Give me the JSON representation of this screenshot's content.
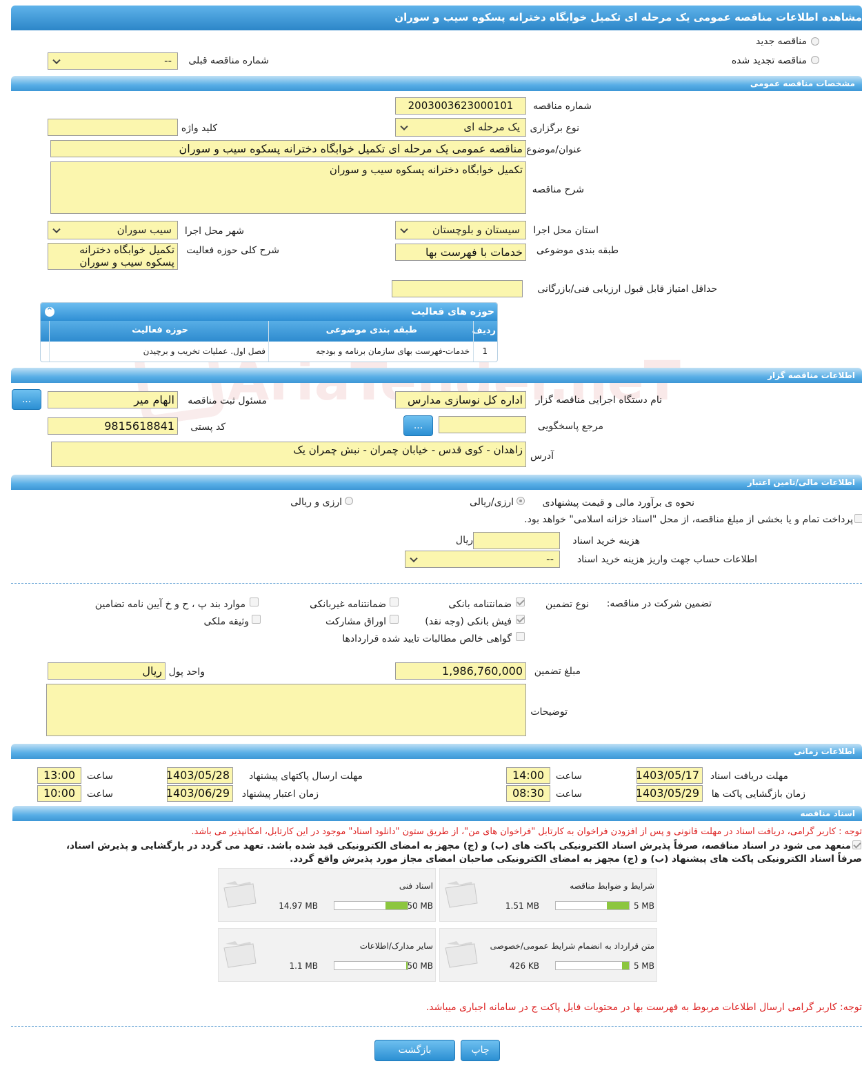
{
  "page_title": "مشاهده اطلاعات مناقصه عمومی یک مرحله ای تکمیل خوابگاه دخترانه پسکوه سیب و سوران",
  "header": {
    "new_tender": "مناقصه جدید",
    "renewed_tender": "مناقصه تجدید شده",
    "prev_tender_label": "شماره مناقصه قبلی",
    "prev_tender_value": "--"
  },
  "general": {
    "section": "مشخصات مناقصه عمومی",
    "tender_no_label": "شماره مناقصه",
    "tender_no": "2003003623000101",
    "keyword_label": "کلید واژه",
    "keyword": "",
    "holding_type_label": "نوع برگزاری",
    "holding_type": "یک مرحله ای",
    "subject_label": "عنوان/موضوع مناقصه",
    "subject": "مناقصه عمومی یک مرحله ای تکمیل خوابگاه دخترانه پسکوه سیب و سوران",
    "description_label": "شرح مناقصه",
    "description": "تکمیل خوابگاه دخترانه پسکوه سیب و سوران",
    "province_label": "استان محل اجرا",
    "province": "سیستان و بلوچستان",
    "city_label": "شهر محل اجرا",
    "city": "سیب سوران",
    "category_label": "طبقه بندی موضوعی",
    "category": "خدمات با فهرست بها",
    "activity_desc_label": "شرح کلی حوزه فعالیت",
    "activity_desc": "تکمیل خوابگاه دخترانه پسکوه سیب و سوران",
    "min_score_label": "حداقل امتیاز قابل قبول ارزیابی فنی/بازرگانی",
    "min_score": ""
  },
  "activities": {
    "title": "حوزه های فعالیت",
    "headers": [
      "ردیف",
      "طبقه بندی موضوعی",
      "حوزه فعالیت"
    ],
    "rows": [
      [
        "1",
        "خدمات-فهرست بهای سازمان برنامه و بودجه",
        "فصل اول. عملیات تخریب و برچیدن"
      ]
    ]
  },
  "organizer": {
    "section": "اطلاعات مناقصه گزار",
    "org_label": "نام دستگاه اجرایی مناقصه گزار",
    "org": "اداره کل نوسازی مدارس",
    "responsible_label": "مسئول ثبت مناقصه",
    "responsible": "الهام میر",
    "reference_label": "مرجع پاسخگویی",
    "reference": "",
    "postal_label": "کد پستی",
    "postal": "9815618841",
    "address_label": "آدرس",
    "address": "زاهدان - کوی قدس - خیابان چمران - نبش چمران یک",
    "more_btn": "..."
  },
  "finance": {
    "section": "اطلاعات مالی/تامین اعتبار",
    "estimate_label": "نحوه ی برآورد مالی و قیمت پیشنهادی",
    "opt_rial": "ارزی/ریالی",
    "opt_fx": "ارزی و ریالی",
    "treasury_text": "پرداخت تمام و یا بخشی از مبلغ مناقصه، از محل \"اسناد خزانه اسلامی\" خواهد بود.",
    "doc_cost_label": "هزینه خرید اسناد",
    "doc_cost": "",
    "rial": "ریال",
    "account_label": "اطلاعات حساب جهت واریز هزینه خرید اسناد",
    "account": "--"
  },
  "guarantee": {
    "label": "تضمین شرکت در مناقصه:",
    "type_label": "نوع تضمین",
    "bank_guarantee": "ضمانتنامه بانکی",
    "nonbank_guarantee": "ضمانتنامه غیربانکی",
    "bylaw_items": "موارد بند پ ، ح و خ آیین نامه تضامین",
    "cash_receipt": "فیش بانکی (وجه نقد)",
    "participation_bonds": "اوراق مشارکت",
    "property_bond": "وثیقه ملکی",
    "claims_certificate": "گواهی خالص مطالبات تایید شده قراردادها",
    "amount_label": "مبلغ تضمین",
    "amount": "1,986,760,000",
    "currency_label": "واحد پول",
    "currency": "ریال",
    "notes_label": "توضیحات",
    "notes": ""
  },
  "timing": {
    "section": "اطلاعات زمانی",
    "doc_deadline_label": "مهلت دریافت اسناد",
    "doc_deadline_date": "1403/05/17",
    "doc_deadline_time": "14:00",
    "submit_deadline_label": "مهلت ارسال پاکتهای پیشنهاد",
    "submit_deadline_date": "1403/05/28",
    "submit_deadline_time": "13:00",
    "opening_label": "زمان بازگشایی پاکت ها",
    "opening_date": "1403/05/29",
    "opening_time": "08:30",
    "validity_label": "زمان اعتبار پیشنهاد",
    "validity_date": "1403/06/29",
    "validity_time": "10:00",
    "time_label": "ساعت"
  },
  "documents": {
    "section": "اسناد مناقصه",
    "notice": "توجه : کاربر گرامی، دریافت اسناد در مهلت قانونی و پس از افزودن فراخوان به کارتابل \"فراخوان های من\"، از طریق ستون \"دانلود اسناد\" موجود در این کارتابل، امکانپذیر می باشد.",
    "pledge_line1": "منعهد می شود در اسناد مناقصه، صرفاً پذیرش اسناد الکترونیکی پاکت های (ب) و (ج) مجهز به امضای الکترونیکی قید شده باشد. تعهد می گردد در بارگشایی و پذیرش اسناد،",
    "pledge_line2": "صرفاً اسناد الکترونیکی پاکت های پیشنهاد (ب) و (ج) مجهز به امضای الکترونیکی صاحبان امضای مجاز مورد پذیرش واقع گردد.",
    "files": [
      {
        "title": "شرایط و ضوابط مناقصه",
        "used": "1.51 MB",
        "max": "5 MB",
        "fraction": 0.3
      },
      {
        "title": "اسناد فنی",
        "used": "14.97 MB",
        "max": "50 MB",
        "fraction": 0.3
      },
      {
        "title": "متن قرارداد به انضمام شرایط عمومی/خصوصی",
        "used": "426 KB",
        "max": "5 MB",
        "fraction": 0.09
      },
      {
        "title": "سایر مدارک/اطلاعات",
        "used": "1.1 MB",
        "max": "50 MB",
        "fraction": 0.02
      }
    ],
    "footer_notice": "توجه: کاربر گرامی ارسال اطلاعات مربوط به فهرست بها در محتویات فایل پاکت ج در سامانه اجباری میباشد."
  },
  "actions": {
    "print": "چاپ",
    "back": "بازگشت"
  },
  "watermark": "AriaTender.neT",
  "colors": {
    "header_blue": "#3d97d6",
    "field_yellow": "#fbf6ae",
    "progress_green": "#8cc63f",
    "notice_red": "#d22222"
  }
}
